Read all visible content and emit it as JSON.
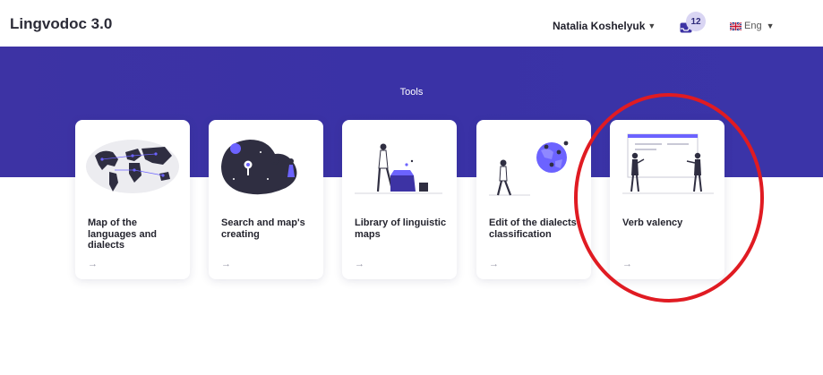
{
  "header": {
    "logo": "Lingvodoc 3.0",
    "user_name": "Natalia Koshelyuk",
    "notifications_count": "12",
    "language": "Eng"
  },
  "banner": {
    "title": "Tools"
  },
  "cards": [
    {
      "label": "Map of the languages and dialects",
      "arrow": "→"
    },
    {
      "label": "Search and map's creating",
      "arrow": "→"
    },
    {
      "label": "Library of linguistic maps",
      "arrow": "→"
    },
    {
      "label": "Edit of the dialects classification",
      "arrow": "→"
    },
    {
      "label": "Verb valency",
      "arrow": "→"
    }
  ],
  "colors": {
    "banner": "#3d33a4",
    "highlight_circle": "#e01b22",
    "accent_purple": "#6c63ff",
    "badge_bg": "#d9d5f3"
  }
}
